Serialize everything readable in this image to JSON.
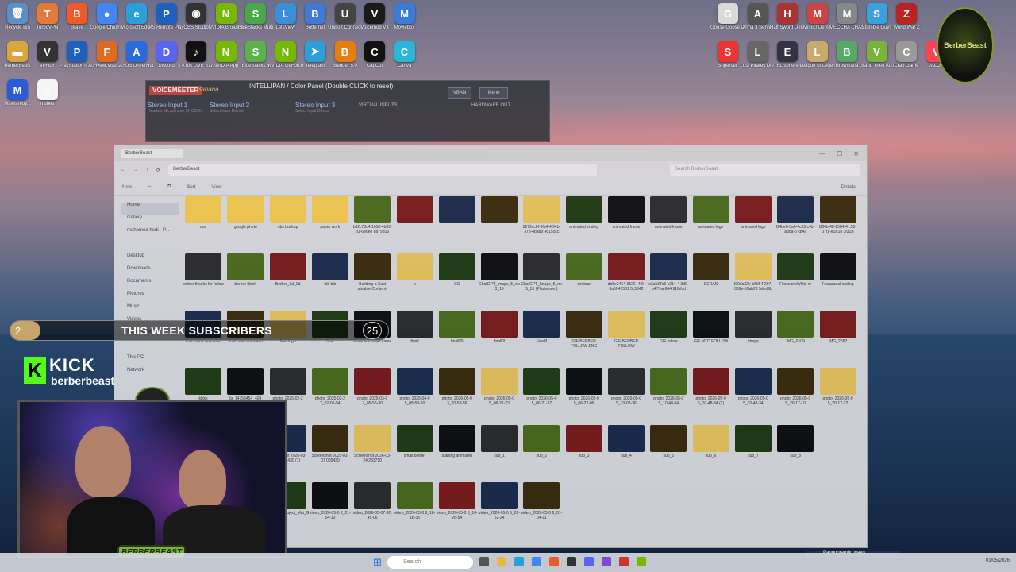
{
  "desktop_left": [
    {
      "label": "Recycle Bin",
      "color": "#5a8fc9",
      "glyph": "🗑"
    },
    {
      "label": "TurboVPN",
      "color": "#e07b39",
      "glyph": "T"
    },
    {
      "label": "Brave",
      "color": "#f05a28",
      "glyph": "B"
    },
    {
      "label": "Google Chrome",
      "color": "#4285f4",
      "glyph": "●"
    },
    {
      "label": "Microsoft Edge",
      "color": "#2b9fd9",
      "glyph": "e"
    },
    {
      "label": "PS Remote Play",
      "color": "#1f5fbf",
      "glyph": "P"
    },
    {
      "label": "OBS Studio",
      "color": "#333",
      "glyph": "◉"
    },
    {
      "label": "NVIDIA Broadcast",
      "color": "#76b900",
      "glyph": "N"
    },
    {
      "label": "BlueStacks Multi-Insta...",
      "color": "#4aa84a",
      "glyph": "S"
    },
    {
      "label": "LetsView",
      "color": "#3a8fd9",
      "glyph": "L"
    },
    {
      "label": "Betternet",
      "color": "#3f7ad9",
      "glyph": "B"
    },
    {
      "label": "Ubisoft Connect",
      "color": "#444",
      "glyph": "U"
    },
    {
      "label": "Voicemod V3",
      "color": "#1a1a1a",
      "glyph": "V"
    },
    {
      "label": "Moviebox",
      "color": "#3b7bd9",
      "glyph": "M"
    }
  ],
  "desktop_left_row2": [
    {
      "label": "BerberBeast",
      "color": "#d6a640",
      "glyph": "▬"
    },
    {
      "label": "VPNLY",
      "color": "#333",
      "glyph": "V"
    },
    {
      "label": "PlayStation® Accessories",
      "color": "#1f5fbf",
      "glyph": "P"
    },
    {
      "label": "FiveM.Visu...",
      "color": "#e06a20",
      "glyph": "F"
    },
    {
      "label": "ASUS DriverHub",
      "color": "#2b6bd9",
      "glyph": "A"
    },
    {
      "label": "Discord",
      "color": "#5865f2",
      "glyph": "D"
    },
    {
      "label": "TikTok LIVE Studio",
      "color": "#111",
      "glyph": "♪"
    },
    {
      "label": "NVIDIA App",
      "color": "#76b900",
      "glyph": "N"
    },
    {
      "label": "BlueStacks 5",
      "color": "#5bb14a",
      "glyph": "S"
    },
    {
      "label": "NVIDIA GeForce",
      "color": "#76b900",
      "glyph": "N"
    },
    {
      "label": "Telegram",
      "color": "#2aa0d9",
      "glyph": "➤"
    },
    {
      "label": "Blender 5.0",
      "color": "#e87d0d",
      "glyph": "B"
    },
    {
      "label": "CapCut",
      "color": "#111",
      "glyph": "C"
    },
    {
      "label": "Canva",
      "color": "#28b6d9",
      "glyph": "C"
    }
  ],
  "desktop_left_row3": [
    {
      "label": "Malwareby...",
      "color": "#2a5bd9",
      "glyph": "M"
    },
    {
      "label": "iTunes",
      "color": "#f5f5f5",
      "glyph": "♫"
    }
  ],
  "desktop_right": [
    {
      "label": "Goose Goose Duck",
      "color": "#d9d9d9",
      "glyph": "G"
    },
    {
      "label": "Arma 3 Server",
      "color": "#555",
      "glyph": "A"
    },
    {
      "label": "Half Sword Demo",
      "color": "#a33",
      "glyph": "H"
    },
    {
      "label": "Mimic! Demo",
      "color": "#c44",
      "glyph": "M"
    },
    {
      "label": "MECCHA CHAMELE...",
      "color": "#888",
      "glyph": "M"
    },
    {
      "label": "Stumble Guys",
      "color": "#3aa0e0",
      "glyph": "S"
    },
    {
      "label": "World War Z",
      "color": "#b22",
      "glyph": "Z"
    }
  ],
  "desktop_right_row2": [
    {
      "label": "Supercell",
      "color": "#e33",
      "glyph": "S"
    },
    {
      "label": "Lost Pirates Die Togeth...",
      "color": "#666",
      "glyph": "L"
    },
    {
      "label": "ELIsphere",
      "color": "#334",
      "glyph": "E"
    },
    {
      "label": "League of Legends",
      "color": "#c8aa6e",
      "glyph": "L"
    },
    {
      "label": "Brewmatia",
      "color": "#5a6",
      "glyph": "B"
    },
    {
      "label": "Grand Theft Auto V Enh...",
      "color": "#7ab33c",
      "glyph": "V"
    },
    {
      "label": "Crab Game",
      "color": "#999",
      "glyph": "C"
    },
    {
      "label": "VALO...",
      "color": "#fa4454",
      "glyph": "V"
    }
  ],
  "voicemeeter": {
    "brand": "VOICEMEETER",
    "edition": "Banana",
    "panel_title": "INTELLIPAN / Color Panel (Double CLICK to reset).",
    "inputs": [
      {
        "title": "Stereo Input 1",
        "sub": "Headset Microphone (3- CORS"
      },
      {
        "title": "Stereo Input 2",
        "sub": "Select Input Device"
      },
      {
        "title": "Stereo Input 3",
        "sub": "Select Input Device"
      }
    ],
    "virtual_inputs": "VIRTUAL INPUTS",
    "hardware_out": "HARDWARE OUT",
    "vban": "VBAN",
    "menu": "Menu"
  },
  "explorer": {
    "tab_title": "BerberBeast",
    "breadcrumb": "BerberBeast",
    "search_placeholder": "Search BerberBeast",
    "toolbar": [
      "New",
      "Sort",
      "View",
      "···"
    ],
    "details": "Details",
    "sidebar": [
      "Home",
      "Gallery",
      "mohamed hedi - P...",
      "",
      "Desktop",
      "Downloads",
      "Documents",
      "Pictures",
      "Music",
      "Videos",
      "Screenshots",
      "",
      "This PC",
      "Network"
    ],
    "files": [
      [
        "doc",
        "google photo",
        "obs buckup",
        "paper work",
        "b82c73c4-1618-4b35-b1-6e6e8 8b79d16",
        "",
        "",
        "",
        "3272cc6f-3fa4-4 94b-373-4ba89 4d155cc",
        "animated ending",
        "animated frame",
        "animated frame",
        "animated logo",
        "animated logo",
        "B4be6-3a6-4c55 c4b-a8ba-5 cb4a",
        "B84bf48-1584-4 c55-07f1-e1B18 3f31B"
      ],
      [
        "berber thanks for follow",
        "berber tiktok",
        "Berber_3d_2d",
        "bib bib",
        "Building-a-Sust ainable-Content- Strategy...",
        "c",
        "CC",
        "ChatGPT_Image_5_mai_2026_22_5 3_19",
        "ChatGPT_Image_5_mai_2026_23_2 5_31 (Photoroom)",
        "contour",
        "db5e2454-3526 -4f0-8a5f-47501 5c5542",
        "e2ab37c3-c214-4 3d0-b4f7-ae9d4 91fbfcd",
        "ECRAN",
        "f20da32e-b69f-4 207-809e-55ab28 5ded9b",
        "FilesnaneWhite m",
        "Fnaaaaaal ending"
      ],
      [
        "final frame animated",
        "final haim animated",
        "final logo",
        "final",
        "finale animated frame",
        "finall",
        "finalll0l",
        "finall0l",
        "FiveM",
        "GIF BERBER FOLLOW ENG",
        "GIF BERBER FOLLOW",
        "GIF follow",
        "GIF MTO FOLLOW",
        "image",
        "IMG_0109",
        "IMG_2662"
      ],
      [
        "klkkk",
        "lp_14753454_404",
        "photo_2025-02-2",
        "photo_2025-02-2 7_02-06-54",
        "photo_2025-03-0 7_09-55-30",
        "photo_2025-04-0 5_08-59-50",
        "photo_2026-05-0 3_20-58-56",
        "photo_2026-05-0 5_06-21-23",
        "photo_2026-05-0 5_06-21-27",
        "photo_2026-05-0 5_06-22-06",
        "photo_2026-05-0 5_10-08-36",
        "photo_2026-05-0 5_10-48-34",
        "photo_2026-05-0 5_10-48-34 (2)",
        "photo_2026-05-0 5_10-48-34",
        "photo_2026-05-0 5_20-17-10",
        "photo_2026-05-0 5_20-17-22"
      ],
      [
        "",
        "qwdcwdx_sqw w5y4a25t4 4c54 w fbdh 6ende-bfk",
        "Screenshot 2025-03-07 005430 (1)",
        "Screenshot 2025-03-07 005430",
        "Screenshot 2026-03-24 233710",
        "small berber",
        "starting animated",
        "sub_1",
        "sub_2",
        "sub_3",
        "sub_4",
        "sub_5",
        "sub_6",
        "sub_7",
        "sub_8"
      ],
      [
        "sub1",
        "Untitled design",
        "Untitled_Project_Mai_Gaming_Gradient_Youtube_Banner_1",
        "video_2026-05-0 2_21-54-10",
        "video_2026-05-07 02-45-06",
        "video_2026-05-0 8_18-18-35",
        "video_2026-05-0 8_16-26-54",
        "video_2026-05-0 6_01-52-24",
        "video_2026-05-0 6_01-04-11"
      ]
    ]
  },
  "overlay": {
    "subs_count": "2",
    "subs_label": "THIS WEEK SUBSCRIBERS",
    "subs_goal": "25",
    "kick_brand": "KICK",
    "kick_user": "berberbeast",
    "cam_badge": "BERBERBEAST",
    "logo_text": "BerberBeast"
  },
  "taskbar": {
    "search_placeholder": "Search",
    "notification": "Pannooramix: wayo",
    "clock": "01/05/2026"
  },
  "colors": {
    "kick_green": "#53fc18",
    "subs_accent": "#c7a46a",
    "badge_green": "#7ab33c"
  }
}
